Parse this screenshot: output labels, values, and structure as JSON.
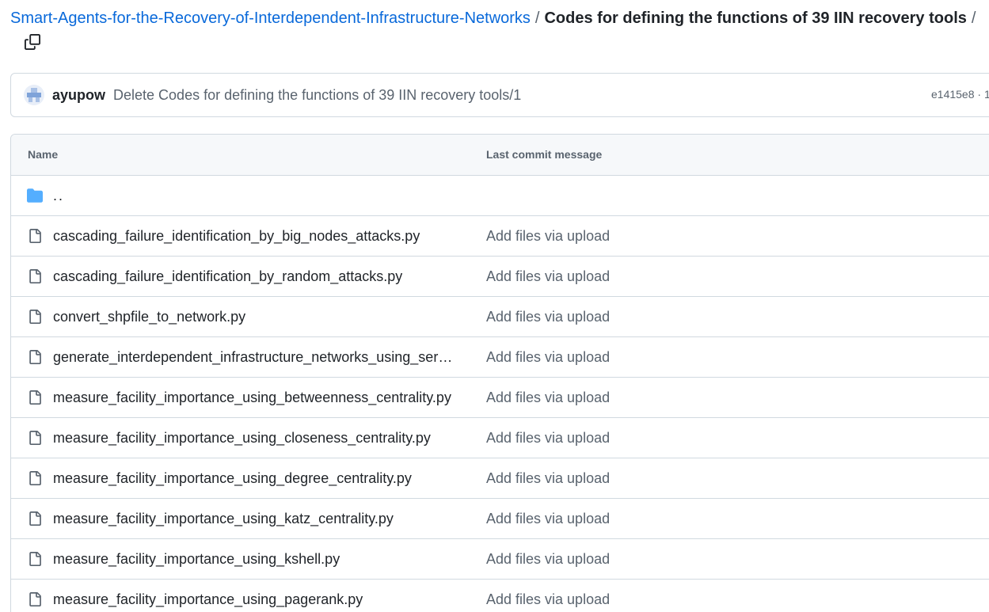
{
  "breadcrumb": {
    "repo": "Smart-Agents-for-the-Recovery-of-Interdependent-Infrastructure-Networks",
    "separator": "/",
    "current": "Codes for defining the functions of 39 IIN recovery tools",
    "trailing_separator": "/"
  },
  "copy_icon": "copy-icon",
  "commit": {
    "author": "ayupow",
    "message": "Delete Codes for defining the functions of 39 IIN recovery tools/1",
    "sha": "e1415e8 · 1"
  },
  "table": {
    "headers": {
      "name": "Name",
      "message": "Last commit message"
    },
    "parent_dir": "..",
    "files": [
      {
        "name": "cascading_failure_identification_by_big_nodes_attacks.py",
        "message": "Add files via upload"
      },
      {
        "name": "cascading_failure_identification_by_random_attacks.py",
        "message": "Add files via upload"
      },
      {
        "name": "convert_shpfile_to_network.py",
        "message": "Add files via upload"
      },
      {
        "name": "generate_interdependent_infrastructure_networks_using_service...",
        "message": "Add files via upload"
      },
      {
        "name": "measure_facility_importance_using_betweenness_centrality.py",
        "message": "Add files via upload"
      },
      {
        "name": "measure_facility_importance_using_closeness_centrality.py",
        "message": "Add files via upload"
      },
      {
        "name": "measure_facility_importance_using_degree_centrality.py",
        "message": "Add files via upload"
      },
      {
        "name": "measure_facility_importance_using_katz_centrality.py",
        "message": "Add files via upload"
      },
      {
        "name": "measure_facility_importance_using_kshell.py",
        "message": "Add files via upload"
      },
      {
        "name": "measure_facility_importance_using_pagerank.py",
        "message": "Add files via upload"
      }
    ]
  },
  "colors": {
    "link": "#0969da",
    "text": "#1f2328",
    "muted": "#59636e",
    "border": "#d1d9e0",
    "header_bg": "#f6f8fa",
    "folder": "#54aeff"
  }
}
